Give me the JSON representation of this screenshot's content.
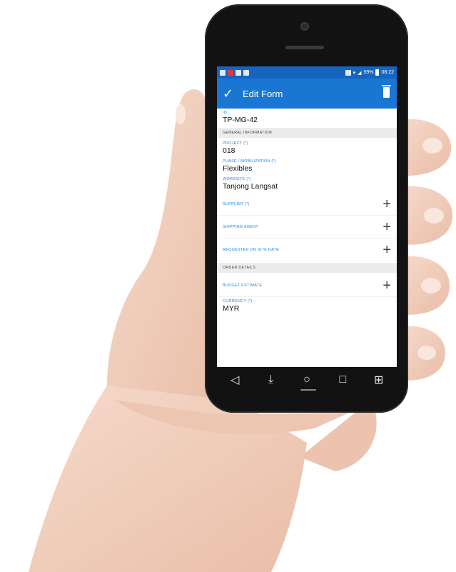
{
  "status_bar": {
    "battery": "59%",
    "time": "08:22"
  },
  "app_bar": {
    "title": "Edit Form",
    "confirm_icon": "check-icon",
    "delete_icon": "trash-icon"
  },
  "form": {
    "id_field": {
      "label": "ID",
      "value": "TP-MG-42"
    },
    "section_general": "GENERAL INFORMATION",
    "project": {
      "label": "PROJECT (*)",
      "value": "018"
    },
    "phase": {
      "label": "PHASE / MOBILIZATION (*)",
      "value": "Flexibles"
    },
    "worksite": {
      "label": "WORKSITE (*)",
      "value": "Tanjong Langsat"
    },
    "supplier": {
      "label": "SUPPLIER (*)"
    },
    "shipping_agent": {
      "label": "SHIPPING AGENT"
    },
    "requested_date": {
      "label": "REQUESTED ON SITE DATE"
    },
    "section_order": "ORDER DETAILS",
    "budget": {
      "label": "BUDGET ESTIMATE"
    },
    "currency": {
      "label": "CURRENCY (*)",
      "value": "MYR"
    }
  },
  "nav_bar": {
    "icons": [
      "back-icon",
      "download-icon",
      "home-icon",
      "recents-icon",
      "grid-icon"
    ]
  },
  "colors": {
    "status_bar": "#1565c0",
    "app_bar": "#1976d2",
    "label": "#1e88e5",
    "section_bg": "#ececec",
    "phone_body": "#121212",
    "skin": "#f3d3c3"
  }
}
